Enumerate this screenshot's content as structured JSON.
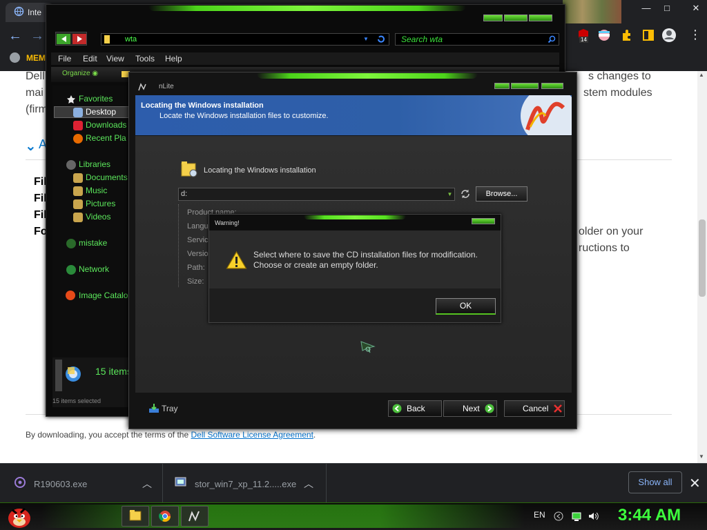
{
  "browser": {
    "tab_title": "Inte",
    "bookmark_label": "MEM",
    "extension_badge": "14",
    "win_controls": [
      "✕",
      "□",
      "—"
    ]
  },
  "webpage": {
    "line1_left": "Dell",
    "line1_right": "s changes to",
    "line2_left": "mai",
    "line2_right": "stem modules",
    "line3_left": "(firm",
    "section_letter": "A",
    "bold_rows": [
      "Fil",
      "Fil",
      "Fil",
      "Fo"
    ],
    "right_row1": "older on your",
    "right_row2": "ructions to",
    "footer_text": "By downloading, you accept the terms of the ",
    "footer_link": "Dell Software License Agreement",
    "footer_end": "."
  },
  "downloads": {
    "items": [
      {
        "name": "R190603.exe",
        "icon": "installer-icon"
      },
      {
        "name": "stor_win7_xp_11.2.....exe",
        "icon": "setup-icon"
      }
    ],
    "show_all": "Show all",
    "close": "✕"
  },
  "explorer": {
    "address": "wta",
    "search_placeholder": "Search wta",
    "menu": [
      "File",
      "Edit",
      "View",
      "Tools",
      "Help"
    ],
    "organize": "Organize ◉",
    "nav": [
      {
        "label": "Favorites",
        "icon": "star-icon"
      },
      {
        "label": "Desktop",
        "icon": "desktop-icon"
      },
      {
        "label": "Downloads",
        "icon": "downloads-icon"
      },
      {
        "label": "Recent Pla",
        "icon": "recent-icon"
      },
      {
        "label": "Libraries",
        "icon": "libraries-icon"
      },
      {
        "label": "Documents",
        "icon": "documents-icon"
      },
      {
        "label": "Music",
        "icon": "music-icon"
      },
      {
        "label": "Pictures",
        "icon": "pictures-icon"
      },
      {
        "label": "Videos",
        "icon": "videos-icon"
      },
      {
        "label": "mistake",
        "icon": "homegroup-icon"
      },
      {
        "label": "Network",
        "icon": "network-icon"
      },
      {
        "label": "Image Catalo",
        "icon": "image-catalog-icon"
      }
    ],
    "items_count": "15 items",
    "status": "15 items selected"
  },
  "nlite": {
    "title": "nLite",
    "header_title": "Locating the Windows installation",
    "header_subtitle": "Locate the Windows installation files to customize.",
    "section_label": "Locating the Windows installation",
    "path_value": "d:",
    "browse_label": "Browse...",
    "fields": [
      "Product name:",
      "Langu",
      "Servic",
      "Versio",
      "Path:",
      "Size:"
    ],
    "tray_label": "Tray",
    "back_label": "Back",
    "next_label": "Next",
    "cancel_label": "Cancel"
  },
  "warning": {
    "title": "Warning!",
    "message_line1": "Select where to save the CD installation files for modification.",
    "message_line2": "Choose or create an empty folder.",
    "ok_label": "OK"
  },
  "taskbar": {
    "language": "EN",
    "clock": "3:44 AM"
  },
  "colors": {
    "accent_green": "#56e020",
    "banner_blue": "#2d5dac",
    "chrome_dark": "#202124",
    "link_blue": "#0672cb"
  }
}
